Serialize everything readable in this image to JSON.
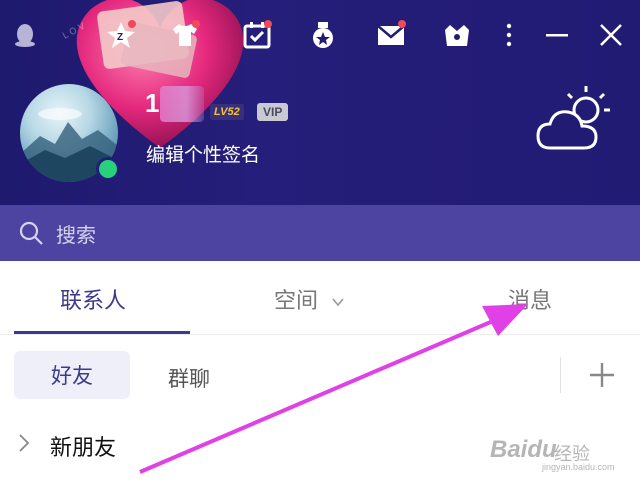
{
  "header": {
    "deco_text": "LOV",
    "nickname_visible": "1",
    "level_badge": "LV52",
    "vip_badge": "VIP",
    "signature": "编辑个性签名",
    "online_status_color": "#27d07a",
    "background_color": "#221b74"
  },
  "toolbar": {
    "icons": [
      "qq-penguin-icon",
      "qzone-star-icon",
      "dress-shirt-icon",
      "calendar-check-icon",
      "medal-icon",
      "mail-icon",
      "shop-bag-icon",
      "more-vertical-icon",
      "minimize-icon",
      "close-icon"
    ]
  },
  "search": {
    "placeholder": "搜索"
  },
  "tabs": [
    {
      "label": "联系人",
      "active": true
    },
    {
      "label": "空间",
      "active": false
    },
    {
      "label": "消息",
      "active": false
    }
  ],
  "subtabs": {
    "friends": "好友",
    "groups": "群聊"
  },
  "list": {
    "item_new_friends": "新朋友"
  },
  "watermark": {
    "brand": "Baidu",
    "sub": "经验",
    "url": "jingyan.baidu.com"
  },
  "colors": {
    "accent": "#3d3a8c",
    "search_bg": "#4c44a0",
    "arrow": "#e040e6",
    "notification_dot": "#f0495a"
  }
}
